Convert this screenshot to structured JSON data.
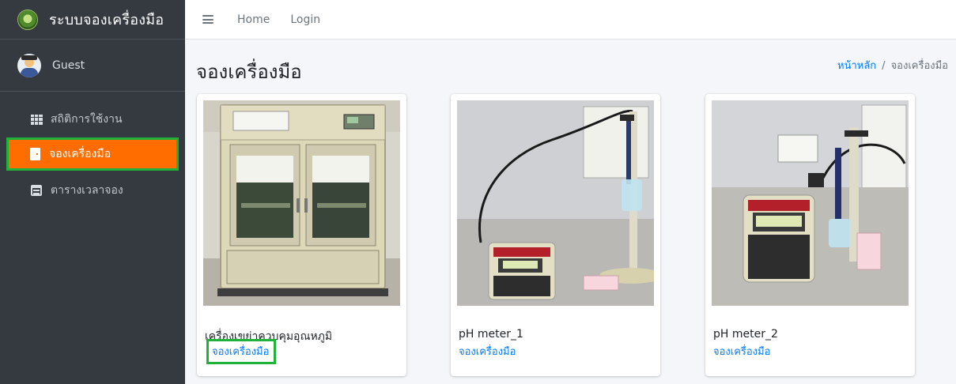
{
  "app": {
    "title": "ระบบจองเครื่องมือ"
  },
  "user": {
    "name": "Guest"
  },
  "sidebar": {
    "items": [
      {
        "label": "สถิติการใช้งาน",
        "icon": "th-grid-icon",
        "active": false
      },
      {
        "label": "จองเครื่องมือ",
        "icon": "door-icon",
        "active": true
      },
      {
        "label": "ตารางเวลาจอง",
        "icon": "calendar-icon",
        "active": false
      }
    ]
  },
  "topbar": {
    "links": [
      "Home",
      "Login"
    ]
  },
  "page": {
    "title": "จองเครื่องมือ",
    "breadcrumb": {
      "home": "หน้าหลัก",
      "separator": "/",
      "current": "จองเครื่องมือ"
    }
  },
  "equipment": [
    {
      "name": "เครื่องเขย่าควบคุมอุณหภูมิ",
      "action": "จองเครื่องมือ"
    },
    {
      "name": "pH meter_1",
      "action": "จองเครื่องมือ"
    },
    {
      "name": "pH meter_2",
      "action": "จองเครื่องมือ"
    }
  ],
  "photo_labels": {
    "meter1": "pH meter 1",
    "meter2": "pH meter 2"
  },
  "colors": {
    "sidebar": "#343a40",
    "active": "#ff6d00",
    "highlight": "#1fb23a",
    "link": "#007bff"
  }
}
